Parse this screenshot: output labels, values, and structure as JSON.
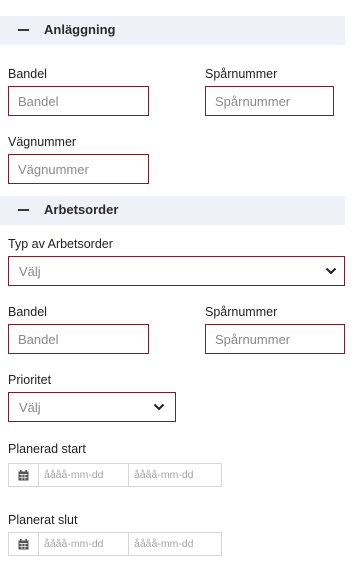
{
  "sections": {
    "anlaggning": {
      "title": "Anläggning"
    },
    "arbetsorder": {
      "title": "Arbetsorder"
    }
  },
  "anlaggning": {
    "bandel": {
      "label": "Bandel",
      "placeholder": "Bandel"
    },
    "sparnummer": {
      "label": "Spårnummer",
      "placeholder": "Spårnummer"
    },
    "vagnummer": {
      "label": "Vägnummer",
      "placeholder": "Vägnummer"
    }
  },
  "arbetsorder": {
    "typ": {
      "label": "Typ av Arbetsorder",
      "value": "Välj"
    },
    "bandel": {
      "label": "Bandel",
      "placeholder": "Bandel"
    },
    "sparnummer": {
      "label": "Spårnummer",
      "placeholder": "Spårnummer"
    },
    "prioritet": {
      "label": "Prioritet",
      "value": "Välj"
    },
    "planerad_start": {
      "label": "Planerad start",
      "from_placeholder": "åååå-mm-dd",
      "to_placeholder": "åååå-mm-dd",
      "icon": "calendar-icon"
    },
    "planerat_slut": {
      "label": "Planerat slut",
      "from_placeholder": "åååå-mm-dd",
      "to_placeholder": "åååå-mm-dd",
      "icon": "calendar-icon"
    }
  },
  "colors": {
    "border_accent": "#7a1e2b",
    "header_bg": "#eef1f8"
  }
}
